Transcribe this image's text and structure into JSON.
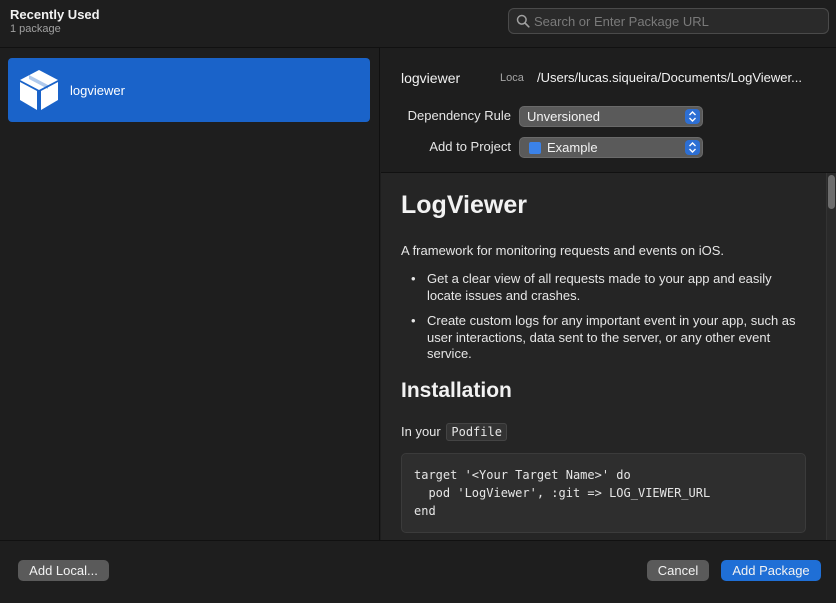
{
  "header": {
    "title": "Recently Used",
    "subtitle": "1 package",
    "search_placeholder": "Search or Enter Package URL"
  },
  "sidebar": {
    "items": [
      {
        "label": "logviewer",
        "selected": true,
        "icon": "package-box-icon"
      }
    ]
  },
  "detail": {
    "name": "logviewer",
    "location_label": "Loca",
    "path": "/Users/lucas.siqueira/Documents/LogViewer...",
    "dependency_rule_label": "Dependency Rule",
    "dependency_rule_value": "Unversioned",
    "add_to_project_label": "Add to Project",
    "add_to_project_value": "Example"
  },
  "readme": {
    "title": "LogViewer",
    "description": "A framework for monitoring requests and events on iOS.",
    "bullets": [
      "Get a clear view of all requests made to your app and easily locate issues and crashes.",
      "Create custom logs for any important event in your app, such as user interactions, data sent to the server, or any other event service."
    ],
    "installation_heading": "Installation",
    "in_your_text": "In your",
    "podfile_code": "Podfile",
    "code_block": "target '<Your Target Name>' do\n  pod 'LogViewer', :git => LOG_VIEWER_URL\nend"
  },
  "footer": {
    "add_local_label": "Add Local...",
    "cancel_label": "Cancel",
    "add_package_label": "Add Package"
  },
  "colors": {
    "accent": "#1a63c9",
    "background": "#1e1e1e"
  }
}
